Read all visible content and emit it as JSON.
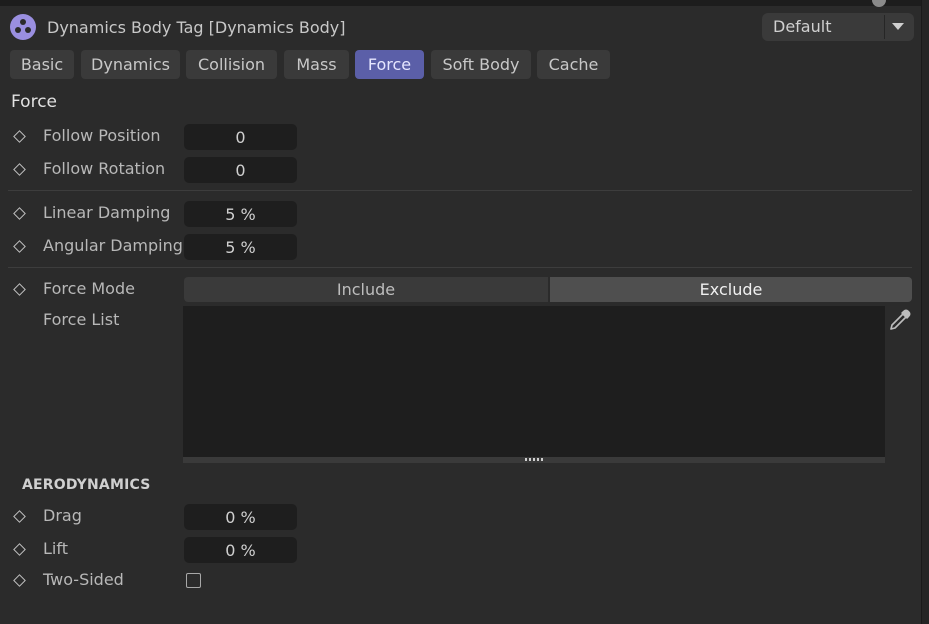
{
  "header": {
    "title": "Dynamics Body Tag [Dynamics Body]",
    "icon": "dynamics-body-tag-icon"
  },
  "preset": {
    "value": "Default"
  },
  "tabs": [
    {
      "label": "Basic",
      "active": false
    },
    {
      "label": "Dynamics",
      "active": false
    },
    {
      "label": "Collision",
      "active": false
    },
    {
      "label": "Mass",
      "active": false
    },
    {
      "label": "Force",
      "active": true
    },
    {
      "label": "Soft Body",
      "active": false
    },
    {
      "label": "Cache",
      "active": false
    }
  ],
  "section": {
    "title": "Force"
  },
  "params": {
    "follow_position": {
      "label": "Follow Position",
      "value": "0"
    },
    "follow_rotation": {
      "label": "Follow Rotation",
      "value": "0"
    },
    "linear_damping": {
      "label": "Linear Damping",
      "value": "5 %"
    },
    "angular_damping": {
      "label": "Angular Damping",
      "value": "5 %"
    },
    "force_mode": {
      "label": "Force Mode",
      "options": [
        "Include",
        "Exclude"
      ],
      "selected": "Exclude"
    },
    "force_list": {
      "label": "Force List"
    }
  },
  "aerodynamics": {
    "title": "AERODYNAMICS",
    "drag": {
      "label": "Drag",
      "value": "0 %"
    },
    "lift": {
      "label": "Lift",
      "value": "0 %"
    },
    "two_sided": {
      "label": "Two-Sided",
      "checked": false
    }
  },
  "colors": {
    "accent": "#5b5fa8",
    "tag_icon": "#9a8fe0",
    "background": "#2b2b2b",
    "field": "#1e1e1e"
  }
}
